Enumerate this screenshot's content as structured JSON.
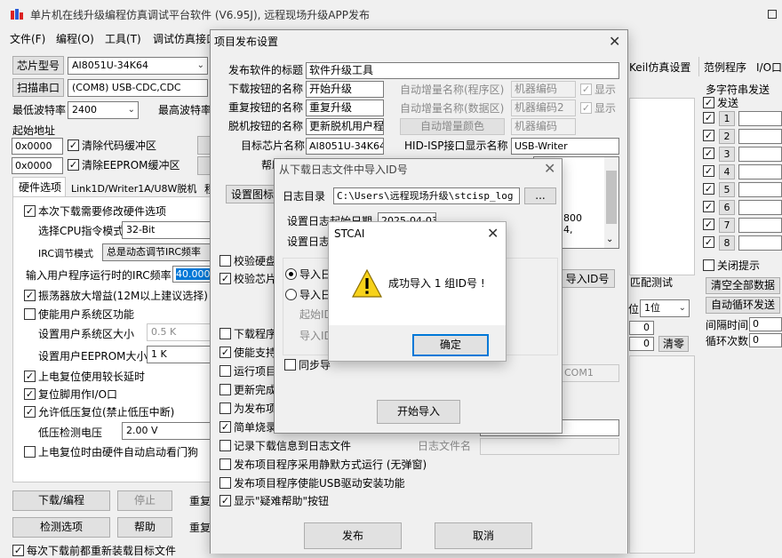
{
  "main": {
    "title": "单片机在线升级编程仿真调试平台软件 (V6.95J), 远程现场升级APP发布",
    "menu": [
      "文件(F)",
      "编程(O)",
      "工具(T)",
      "调试仿真接口"
    ],
    "chip_type_btn": "芯片型号",
    "chip_type_value": "AI8051U-34K64",
    "scan_port_btn": "扫描串口",
    "port_value": "(COM8) USB-CDC,CDC",
    "min_baud_label": "最低波特率",
    "min_baud_value": "2400",
    "max_baud_label": "最高波特率",
    "start_addr_label": "起始地址",
    "addr1": "0x0000",
    "clear_code_label": "清除代码缓冲区",
    "addr2": "0x0000",
    "clear_eeprom_label": "清除EEPROM缓冲区",
    "tabs": [
      "硬件选项",
      "Link1D/Writer1A/U8W脱机",
      "程"
    ],
    "hw_modify": "本次下载需要修改硬件选项",
    "cpu_mode_label": "选择CPU指令模式",
    "cpu_mode_value": "32-Bit",
    "irc_mode_label": "IRC调节模式",
    "irc_mode_value": "总是动态调节IRC频率",
    "irc_freq_label": "输入用户程序运行时的IRC频率",
    "irc_freq_value": "40.000",
    "osc_amp": "振荡器放大增益(12M以上建议选择)",
    "user_sys_area": "使能用户系统区功能",
    "user_sys_size_label": "设置用户系统区大小",
    "user_sys_size_value": "0.5 K",
    "user_eeprom_label": "设置用户EEPROM大小",
    "user_eeprom_value": "1 K",
    "power_reset_delay": "上电复位使用较长延时",
    "reset_pin_io": "复位脚用作I/O口",
    "low_volt_reset": "允许低压复位(禁止低压中断)",
    "low_volt_label": "低压检测电压",
    "low_volt_value": "2.00 V",
    "wdt_on_reset": "上电复位时由硬件自动启动看门狗",
    "download_btn": "下载/编程",
    "stop_btn": "停止",
    "redo1": "重复",
    "check_btn": "检测选项",
    "help_btn": "帮助",
    "redo2": "重复",
    "reload_each": "每次下载前都重新装载目标文件",
    "right_tabs": [
      "Keil仿真设置",
      "范例程序",
      "I/O口"
    ],
    "multi_send_title": "多字符串发送",
    "send_label": "发送",
    "send_rows": [
      "1",
      "2",
      "3",
      "4",
      "5",
      "6",
      "7",
      "8"
    ],
    "close_hint": "关闭提示",
    "clear_all": "清空全部数据",
    "auto_loop": "自动循环发送",
    "interval_label": "间隔时间",
    "interval_value": "0",
    "loop_count_label": "循环次数",
    "loop_count_value": "0",
    "match_test": "匹配测试",
    "bits_value": "1位",
    "clear_zero": "清零",
    "zero1": "0",
    "zero2": "0",
    "mid_vals": "0"
  },
  "publish": {
    "title": "项目发布设置",
    "sw_title_label": "发布软件的标题",
    "sw_title_value": "软件升级工具",
    "dl_btn_name_label": "下载按钮的名称",
    "dl_btn_name_value": "开始升级",
    "redo_btn_name_label": "重复按钮的名称",
    "redo_btn_name_value": "重复升级",
    "offline_btn_name_label": "脱机按钮的名称",
    "offline_btn_name_value": "更新脱机用户程",
    "target_chip_label": "目标芯片名称",
    "target_chip_value": "AI8051U-34K64",
    "auto_inc_prog_label": "自动增量名称(程序区)",
    "auto_inc_prog_value": "机器编码",
    "auto_inc_data_label": "自动增量名称(数据区)",
    "auto_inc_data_value": "机器编码2",
    "auto_inc_color_btn": "自动增量颜色",
    "auto_inc_color_value": "机器编码",
    "show1": "显示",
    "show2": "显示",
    "hid_label": "HID-ISP接口显示名称",
    "hid_value": "USB-Writer",
    "help_label": "帮助",
    "set_icon_btn": "设置图标",
    "verify_hw": "校验硬盘",
    "verify_chip": "校验芯片",
    "import_id_btn": "导入ID号",
    "dl_prog": "下载程序",
    "enable_support": "使能支持",
    "run_project": "运行项目",
    "update_done": "更新完成",
    "for_publish": "为发布项",
    "simple_burn": "简单烧录",
    "log_dl": "记录下载信息到日志文件",
    "log_file_label": "日志文件名",
    "static_run": "发布项目程序采用静默方式运行 (无弹窗)",
    "usb_driver": "发布项目程序使能USB驱动安装功能",
    "show_help": "显示\"疑难帮助\"按钮",
    "publish_btn": "发布",
    "cancel_btn": "取消",
    "textarea_frag1": "800",
    "textarea_frag2": "4,",
    "com_value": "COM1"
  },
  "importlog": {
    "title": "从下载日志文件中导入ID号",
    "dir_label": "日志目录",
    "dir_value": "C:\\Users\\远程现场升级\\stcisp_log",
    "browse": "...",
    "set_date_label": "设置日志起始日期",
    "date_value": "2025-04-03",
    "set_log_label": "设置日志",
    "import_radio1": "导入日",
    "import_radio2": "导入日",
    "start_id_label": "起始ID",
    "import_id_label": "导入ID",
    "sync_label": "同步导",
    "start_import_btn": "开始导入"
  },
  "msgbox": {
    "title": "STCAI",
    "message": "成功导入 1 组ID号 !",
    "ok_btn": "确定"
  }
}
